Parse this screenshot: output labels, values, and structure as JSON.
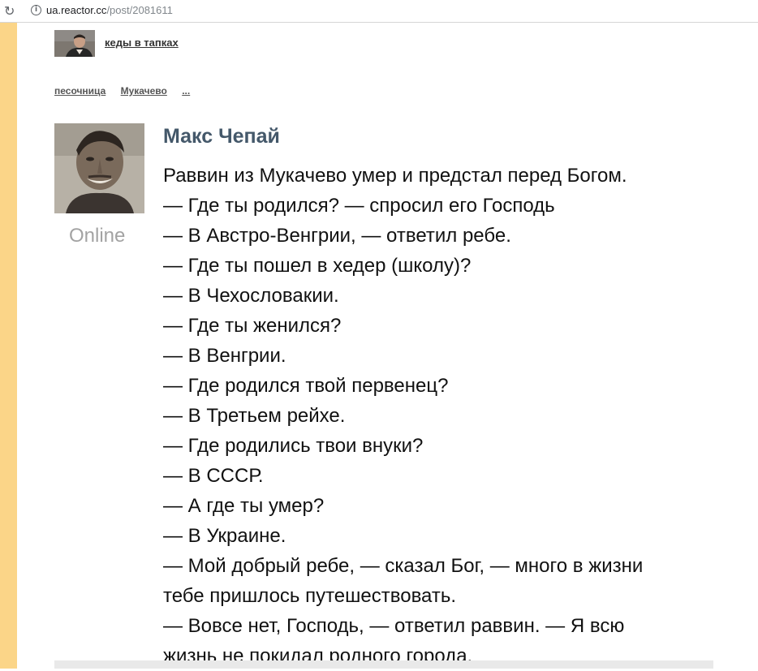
{
  "browser": {
    "url_host": "ua.reactor.cc",
    "url_path": "/post/2081611"
  },
  "header": {
    "username": "кеды в тапках"
  },
  "tags": [
    "песочница",
    "Мукачево",
    "..."
  ],
  "post": {
    "author": "Макс Чепай",
    "status": "Online",
    "lines": [
      "Раввин из Мукачево умер и предстал перед Богом.",
      "— Где ты родился? — спросил его Господь",
      "— В Австро-Венгрии, — ответил ребе.",
      "— Где ты пошел в хедер (школу)?",
      "— В Чехословакии.",
      "— Где ты женился?",
      "— В Венгрии.",
      "— Где родился твой первенец?",
      "— В Третьем рейхе.",
      "— Где родились твои внуки?",
      "— В СССР.",
      "— А где ты умер?",
      "— В Украине.",
      "— Мой добрый ребе, — сказал Бог, — много в жизни",
      "тебе пришлось путешествовать.",
      "— Вовсе нет, Господь, — ответил раввин. — Я всю",
      "жизнь не покидал родного города."
    ]
  }
}
